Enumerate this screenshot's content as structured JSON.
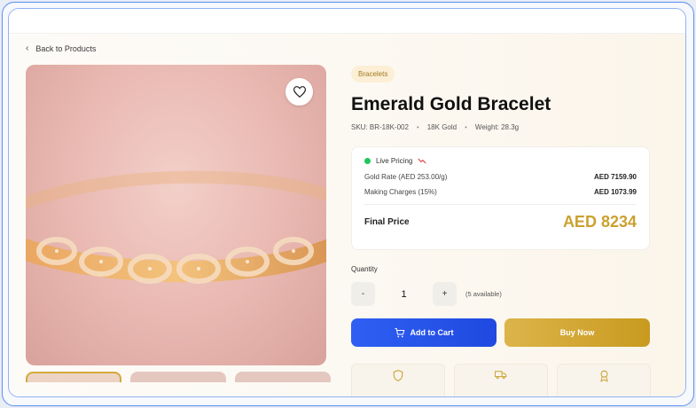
{
  "nav": {
    "back_label": "Back to Products"
  },
  "product": {
    "category": "Bracelets",
    "title": "Emerald Gold Bracelet",
    "sku": "SKU: BR-18K-002",
    "purity": "18K Gold",
    "weight": "Weight: 28.3g"
  },
  "pricing": {
    "live_label": "Live Pricing",
    "gold_rate_label": "Gold Rate (AED 253.00/g)",
    "gold_rate_value": "AED 7159.90",
    "making_label": "Making Charges (15%)",
    "making_value": "AED 1073.99",
    "final_label": "Final Price",
    "final_value": "AED 8234"
  },
  "quantity": {
    "label": "Quantity",
    "minus": "-",
    "value": "1",
    "plus": "+",
    "available": "(5 available)"
  },
  "actions": {
    "cart_label": "Add to Cart",
    "buy_label": "Buy Now"
  },
  "colors": {
    "primary": "#2f5ff3",
    "gold": "#caa12f",
    "live": "#22c55e",
    "trend_down": "#d94848"
  },
  "icons": [
    "chevron-left-icon",
    "heart-icon",
    "trend-down-icon",
    "cart-icon",
    "shield-icon",
    "truck-icon",
    "award-icon"
  ]
}
